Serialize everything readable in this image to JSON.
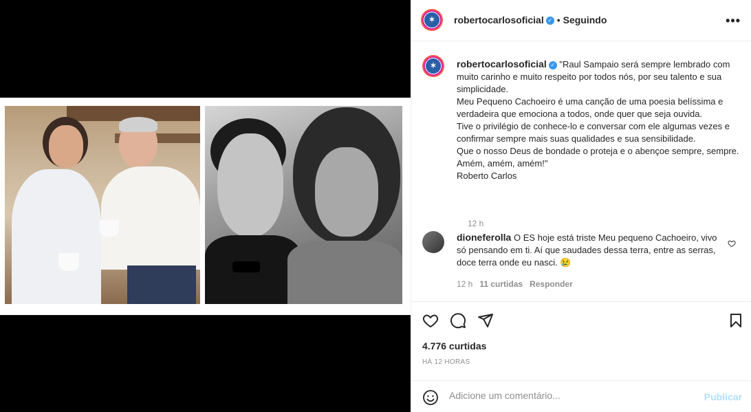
{
  "post": {
    "username": "robertocarlosoficial",
    "follow_status": "Seguindo",
    "dot": "•",
    "more": "•••",
    "avatar_initial": "✶"
  },
  "caption": {
    "username": "robertocarlosoficial",
    "text": "\"Raul Sampaio será sempre lembrado com muito carinho e muito respeito por todos nós, por seu talento e sua simplicidade.\nMeu Pequeno Cachoeiro é uma canção de uma poesia belíssima e verdadeira que emociona a todos, onde quer que seja ouvida.\nTive o privilégio de conhece-lo e conversar com ele algumas vezes e confirmar sempre mais suas qualidades e sua sensibilidade.\nQue o nosso Deus de bondade o proteja e o abençoe sempre, sempre.\nAmém, amém, amém!\"\nRoberto Carlos",
    "time": "12 h"
  },
  "comment": {
    "username": "dioneferolla",
    "text": "O ES hoje está triste Meu pequeno Cachoeiro, vivo só pensando em ti. Aí que saudades dessa terra, entre as serras, doce terra onde eu nasci. 😢",
    "time": "12 h",
    "likes": "11 curtidas",
    "reply": "Responder"
  },
  "stats": {
    "likes": "4.776 curtidas",
    "ago": "HÁ 12 HORAS"
  },
  "add_comment": {
    "placeholder": "Adicione um comentário...",
    "publish": "Publicar"
  },
  "colors": {
    "accent": "#3897f0",
    "publish_disabled": "#b2dffc",
    "muted": "#8e8e8e"
  }
}
